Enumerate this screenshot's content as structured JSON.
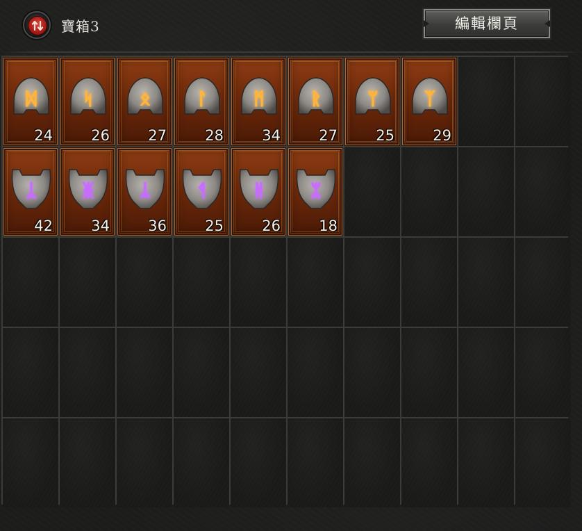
{
  "header": {
    "title": "寶箱3",
    "swap_icon": "swap-arrows-icon",
    "edit_tab_label": "編輯欄頁"
  },
  "grid": {
    "columns": 10,
    "rows": 5
  },
  "colors": {
    "item_bg": "#6f2a0b",
    "rune_glow_gold": "#ffb43c",
    "rune_glow_purple": "#c86cff",
    "stone": "#8d8a86"
  },
  "items": [
    {
      "kind": "condition-rune",
      "icon": "gold-rune-icon",
      "glyph": "ᛞ",
      "quantity": "24",
      "row": 0,
      "col": 0
    },
    {
      "kind": "condition-rune",
      "icon": "gold-rune-icon",
      "glyph": "ᛋ",
      "quantity": "26",
      "row": 0,
      "col": 1
    },
    {
      "kind": "condition-rune",
      "icon": "gold-rune-icon",
      "glyph": "ᛟ",
      "quantity": "27",
      "row": 0,
      "col": 2
    },
    {
      "kind": "condition-rune",
      "icon": "gold-rune-icon",
      "glyph": "ᛚ",
      "quantity": "28",
      "row": 0,
      "col": 3
    },
    {
      "kind": "condition-rune",
      "icon": "gold-rune-icon",
      "glyph": "ᛗ",
      "quantity": "34",
      "row": 0,
      "col": 4
    },
    {
      "kind": "condition-rune",
      "icon": "gold-rune-icon",
      "glyph": "ᚱ",
      "quantity": "27",
      "row": 0,
      "col": 5
    },
    {
      "kind": "condition-rune",
      "icon": "gold-rune-icon",
      "glyph": "ᛘ",
      "quantity": "25",
      "row": 0,
      "col": 6
    },
    {
      "kind": "condition-rune",
      "icon": "gold-rune-icon",
      "glyph": "ᛉ",
      "quantity": "29",
      "row": 0,
      "col": 7
    },
    {
      "kind": "effect-rune",
      "icon": "purple-rune-icon",
      "glyph": "ᛣ",
      "quantity": "42",
      "row": 1,
      "col": 0
    },
    {
      "kind": "effect-rune",
      "icon": "purple-rune-icon",
      "glyph": "ᛤ",
      "quantity": "34",
      "row": 1,
      "col": 1
    },
    {
      "kind": "effect-rune",
      "icon": "purple-rune-icon",
      "glyph": "ᛦ",
      "quantity": "36",
      "row": 1,
      "col": 2
    },
    {
      "kind": "effect-rune",
      "icon": "purple-rune-icon",
      "glyph": "ᛩ",
      "quantity": "25",
      "row": 1,
      "col": 3
    },
    {
      "kind": "effect-rune",
      "icon": "purple-rune-icon",
      "glyph": "ᚻ",
      "quantity": "26",
      "row": 1,
      "col": 4
    },
    {
      "kind": "effect-rune",
      "icon": "purple-rune-icon",
      "glyph": "ᛯ",
      "quantity": "18",
      "row": 1,
      "col": 5
    }
  ]
}
